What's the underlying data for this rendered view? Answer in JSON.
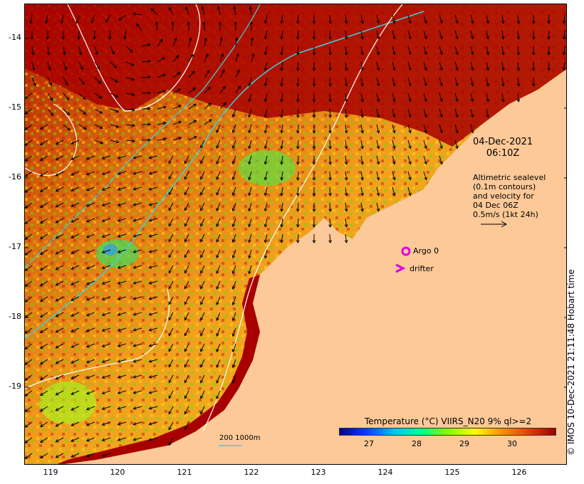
{
  "map": {
    "date": "04-Dec-2021",
    "time": "06:10Z",
    "legend_lines": [
      "Altimetric sealevel",
      "(0.1m contours)",
      "and velocity for",
      "04 Dec 06Z",
      "0.5m/s (1kt 24h)"
    ],
    "lat_labels": [
      "-14",
      "-15",
      "-16",
      "-17",
      "-18",
      "-19"
    ],
    "lon_labels": [
      "119",
      "120",
      "121",
      "122",
      "123",
      "124",
      "125",
      "126"
    ],
    "argo_label": "Argo 0",
    "drifter_label": "drifter",
    "scale_label": "200  1000m",
    "colorbar_title": "Temperature (°C) VIIRS_N20 9% ql>=2",
    "colorbar_ticks": [
      "27",
      "28",
      "29",
      "30"
    ],
    "credit": "© IMOS 10-Dec-2021 21:11:48 Hobart time",
    "colors": {
      "land": "#fdc998",
      "warm": "#a80000",
      "mid": "#e07a10",
      "cool": "#3aa0e0",
      "contour_white": "#ffffff",
      "isobath_cyan": "#40d0d8",
      "argo": "#e000e0"
    },
    "colorbar_stops": [
      "#000090",
      "#0040ff",
      "#00c0ff",
      "#00ff90",
      "#80ff00",
      "#ffff00",
      "#ff9000",
      "#e04000",
      "#a00000"
    ]
  }
}
